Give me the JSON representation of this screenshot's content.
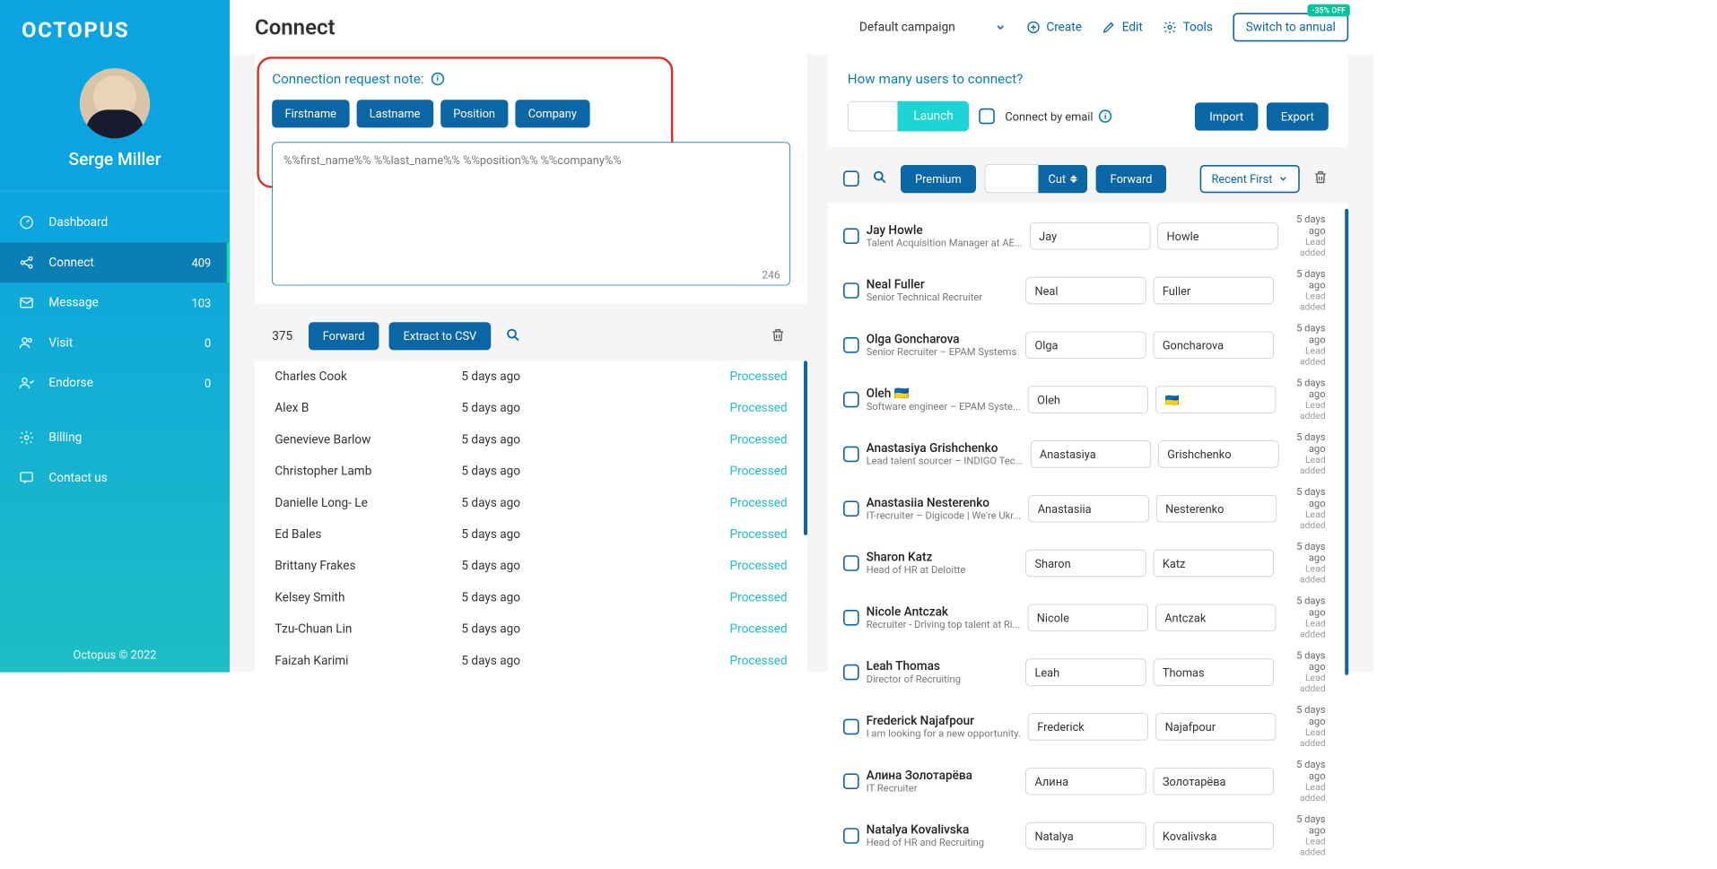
{
  "brand": "OCTOPUS",
  "user": {
    "name": "Serge Miller"
  },
  "nav": {
    "items": [
      {
        "label": "Dashboard",
        "count": ""
      },
      {
        "label": "Connect",
        "count": "409"
      },
      {
        "label": "Message",
        "count": "103"
      },
      {
        "label": "Visit",
        "count": "0"
      },
      {
        "label": "Endorse",
        "count": "0"
      },
      {
        "label": "Billing",
        "count": ""
      },
      {
        "label": "Contact us",
        "count": ""
      }
    ]
  },
  "footer": "Octopus © 2022",
  "page": {
    "title": "Connect"
  },
  "header": {
    "campaign": "Default campaign",
    "create": "Create",
    "edit": "Edit",
    "tools": "Tools",
    "switch": "Switch to annual",
    "badge": "-35% OFF"
  },
  "note": {
    "label": "Connection request note:",
    "vars": [
      "Firstname",
      "Lastname",
      "Position",
      "Company"
    ],
    "text": "%%first_name%% %%last_name%% %%position%% %%company%%",
    "charcount": "246"
  },
  "forwardBar": {
    "count": "375",
    "forward": "Forward",
    "extract": "Extract to CSV"
  },
  "processed": [
    {
      "name": "Charles Cook",
      "time": "5 days ago",
      "status": "Processed"
    },
    {
      "name": "Alex B",
      "time": "5 days ago",
      "status": "Processed"
    },
    {
      "name": "Genevieve Barlow",
      "time": "5 days ago",
      "status": "Processed"
    },
    {
      "name": "Christopher Lamb",
      "time": "5 days ago",
      "status": "Processed"
    },
    {
      "name": "Danielle Long- Le",
      "time": "5 days ago",
      "status": "Processed"
    },
    {
      "name": "Ed Bales",
      "time": "5 days ago",
      "status": "Processed"
    },
    {
      "name": "Brittany Frakes",
      "time": "5 days ago",
      "status": "Processed"
    },
    {
      "name": "Kelsey Smith",
      "time": "5 days ago",
      "status": "Processed"
    },
    {
      "name": "Tzu-Chuan Lin",
      "time": "5 days ago",
      "status": "Processed"
    },
    {
      "name": "Faizah Karimi",
      "time": "5 days ago",
      "status": "Processed"
    }
  ],
  "connect": {
    "label": "How many users to connect?",
    "launch": "Launch",
    "byEmail": "Connect by email",
    "import": "Import",
    "export": "Export"
  },
  "filterBar": {
    "premium": "Premium",
    "cut": "Cut",
    "forward": "Forward",
    "sort": "Recent First"
  },
  "leads": [
    {
      "name": "Jay Howle",
      "title": "Talent Acquisition Manager at AE...",
      "first": "Jay",
      "last": "Howle",
      "time": "5 days ago",
      "status": "Lead added"
    },
    {
      "name": "Neal Fuller",
      "title": "Senior Technical Recruiter",
      "first": "Neal",
      "last": "Fuller",
      "time": "5 days ago",
      "status": "Lead added"
    },
    {
      "name": "Olga Goncharova",
      "title": "Senior Recruiter – EPAM Systems",
      "first": "Olga",
      "last": "Goncharova",
      "time": "5 days ago",
      "status": "Lead added"
    },
    {
      "name": "Oleh 🇺🇦",
      "title": "Software engineer – EPAM Syste...",
      "first": "Oleh",
      "last": "🇺🇦",
      "time": "5 days ago",
      "status": "Lead added"
    },
    {
      "name": "Anastasiya Grishchenko",
      "title": "Lead talent sourcer – INDIGO Tec...",
      "first": "Anastasiya",
      "last": "Grishchenko",
      "time": "5 days ago",
      "status": "Lead added"
    },
    {
      "name": "Anastasiia Nesterenko",
      "title": "IT-recruiter – Digicode | We're Ukr...",
      "first": "Anastasiia",
      "last": "Nesterenko",
      "time": "5 days ago",
      "status": "Lead added"
    },
    {
      "name": "Sharon Katz",
      "title": "Head of HR at Deloitte",
      "first": "Sharon",
      "last": "Katz",
      "time": "5 days ago",
      "status": "Lead added"
    },
    {
      "name": "Nicole Antczak",
      "title": "Recruiter - Driving top talent at Ri...",
      "first": "Nicole",
      "last": "Antczak",
      "time": "5 days ago",
      "status": "Lead added"
    },
    {
      "name": "Leah Thomas",
      "title": "Director of Recruiting",
      "first": "Leah",
      "last": "Thomas",
      "time": "5 days ago",
      "status": "Lead added"
    },
    {
      "name": "Frederick Najafpour",
      "title": "I am looking for a new opportunity.",
      "first": "Frederick",
      "last": "Najafpour",
      "time": "5 days ago",
      "status": "Lead added"
    },
    {
      "name": "Алина Золотарёва",
      "title": "IT Recruiter",
      "first": "Алина",
      "last": "Золотарёва",
      "time": "5 days ago",
      "status": "Lead added"
    },
    {
      "name": "Natalya Kovalivska",
      "title": "Head of HR and Recruiting",
      "first": "Natalya",
      "last": "Kovalivska",
      "time": "5 days ago",
      "status": "Lead added"
    }
  ]
}
